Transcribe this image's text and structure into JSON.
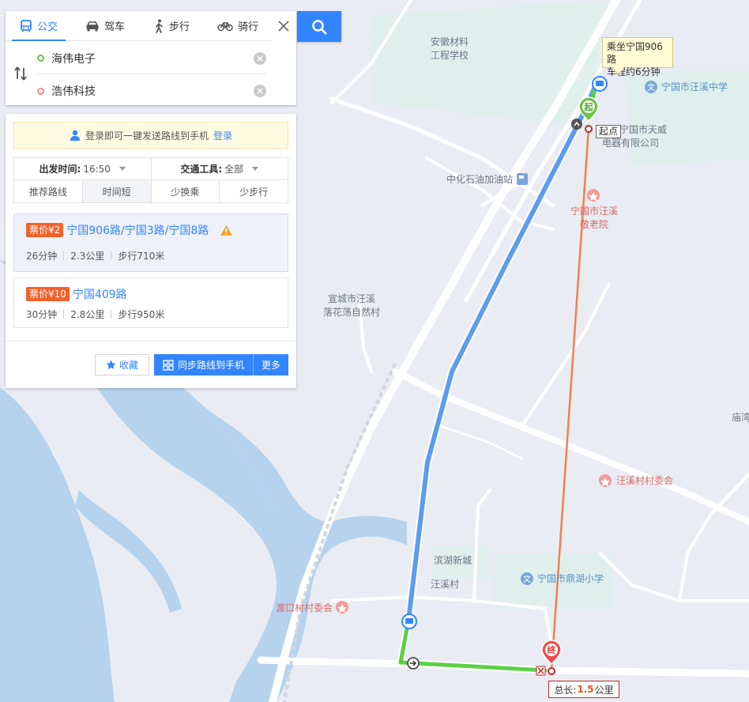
{
  "mode_tabs": [
    {
      "label": "公交",
      "icon": "bus-icon",
      "active": true
    },
    {
      "label": "驾车",
      "icon": "car-icon",
      "active": false
    },
    {
      "label": "步行",
      "icon": "walk-icon",
      "active": false
    },
    {
      "label": "骑行",
      "icon": "bike-icon",
      "active": false
    }
  ],
  "start": {
    "value": "海伟电子"
  },
  "end": {
    "value": "浩伟科技"
  },
  "login": {
    "text": "登录即可一键发送路线到手机",
    "link": "登录"
  },
  "filters": {
    "departure_label": "出发时间:",
    "departure_value": "16:50",
    "transport_label": "交通工具:",
    "transport_value": "全部"
  },
  "sort_tabs": [
    "推荐路线",
    "时间短",
    "少换乘",
    "少步行"
  ],
  "routes": [
    {
      "price": "票价¥2",
      "name": "宁国906路/宁国3路/宁国8路",
      "time": "26分钟",
      "distance": "2.3公里",
      "walk": "步行710米",
      "warning": true
    },
    {
      "price": "票价¥10",
      "name": "宁国409路",
      "time": "30分钟",
      "distance": "2.8公里",
      "walk": "步行950米",
      "warning": false
    }
  ],
  "actions": {
    "favorite": "收藏",
    "sync": "同步路线到手机",
    "more": "更多"
  },
  "map": {
    "callout_line1": "乘坐宁国906路",
    "callout_line2": "车程约6分钟",
    "start_marker": "起",
    "start_tag": "起点",
    "end_marker": "终",
    "total_label": "总长:",
    "total_value": "1.5",
    "total_unit": "公里",
    "labels": {
      "school1_a": "安徽材料",
      "school1_b": "工程学校",
      "school2": "宁国市汪溪中学",
      "company_a": "宁国市天威",
      "company_b": "电器有限公司",
      "gas": "中化石油加油站",
      "nursing_a": "宁国市汪溪",
      "nursing_b": "敬老院",
      "village_a": "宣城市汪溪",
      "village_b": "落花荡自然村",
      "committee1": "汪溪村村委会",
      "binhu": "滨湖新城",
      "wangxi": "汪溪村",
      "school3": "宁国市鼎湖小学",
      "committee2": "渡口村村委会",
      "edge": "庙湾"
    }
  },
  "colors": {
    "accent": "#3385ff",
    "bus_route": "#5b9cf0",
    "walk_route": "#5cd045",
    "straight_line": "#f5804c",
    "water": "#b6d3ee",
    "price_badge": "#f2612c"
  }
}
